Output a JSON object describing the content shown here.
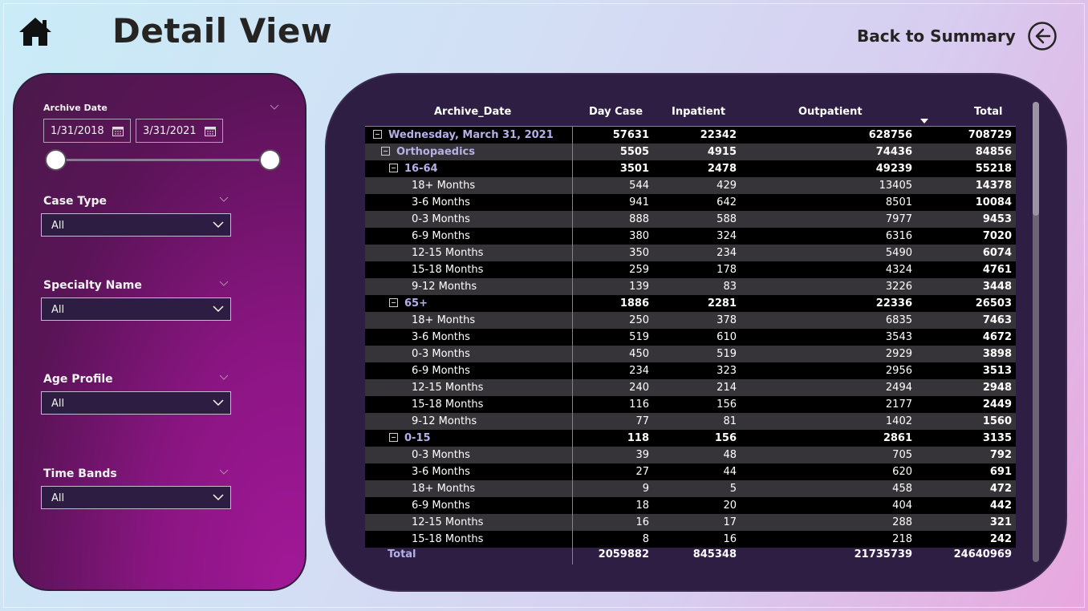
{
  "header": {
    "title": "Detail View",
    "back_label": "Back to Summary",
    "home_icon": "home-icon",
    "back_icon": "arrow-left-circle-icon"
  },
  "filters": {
    "archive_date": {
      "label": "Archive Date",
      "start": "1/31/2018",
      "end": "3/31/2021",
      "range_fraction": [
        0.0,
        1.0
      ]
    },
    "case_type": {
      "label": "Case Type",
      "value": "All"
    },
    "specialty_name": {
      "label": "Specialty Name",
      "value": "All"
    },
    "age_profile": {
      "label": "Age Profile",
      "value": "All"
    },
    "time_bands": {
      "label": "Time Bands",
      "value": "All"
    }
  },
  "table": {
    "columns": [
      "Archive_Date",
      "Day Case",
      "Inpatient",
      "Outpatient",
      "Total"
    ],
    "sorted_column": "Outpatient",
    "rows": [
      {
        "label": "Wednesday, March 31, 2021",
        "level": 0,
        "group": true,
        "expander": true,
        "day": "57631",
        "inp": "22342",
        "out": "628756",
        "tot": "708729"
      },
      {
        "label": "Orthopaedics",
        "level": 1,
        "group": true,
        "expander": true,
        "day": "5505",
        "inp": "4915",
        "out": "74436",
        "tot": "84856"
      },
      {
        "label": "16-64",
        "level": 2,
        "group": true,
        "expander": true,
        "day": "3501",
        "inp": "2478",
        "out": "49239",
        "tot": "55218"
      },
      {
        "label": "18+ Months",
        "level": 3,
        "day": "544",
        "inp": "429",
        "out": "13405",
        "tot": "14378"
      },
      {
        "label": "3-6 Months",
        "level": 3,
        "day": "941",
        "inp": "642",
        "out": "8501",
        "tot": "10084"
      },
      {
        "label": "0-3 Months",
        "level": 3,
        "day": "888",
        "inp": "588",
        "out": "7977",
        "tot": "9453"
      },
      {
        "label": "6-9 Months",
        "level": 3,
        "day": "380",
        "inp": "324",
        "out": "6316",
        "tot": "7020"
      },
      {
        "label": "12-15 Months",
        "level": 3,
        "day": "350",
        "inp": "234",
        "out": "5490",
        "tot": "6074"
      },
      {
        "label": "15-18 Months",
        "level": 3,
        "day": "259",
        "inp": "178",
        "out": "4324",
        "tot": "4761"
      },
      {
        "label": "9-12 Months",
        "level": 3,
        "day": "139",
        "inp": "83",
        "out": "3226",
        "tot": "3448"
      },
      {
        "label": "65+",
        "level": 2,
        "group": true,
        "expander": true,
        "day": "1886",
        "inp": "2281",
        "out": "22336",
        "tot": "26503"
      },
      {
        "label": "18+ Months",
        "level": 3,
        "day": "250",
        "inp": "378",
        "out": "6835",
        "tot": "7463"
      },
      {
        "label": "3-6 Months",
        "level": 3,
        "day": "519",
        "inp": "610",
        "out": "3543",
        "tot": "4672"
      },
      {
        "label": "0-3 Months",
        "level": 3,
        "day": "450",
        "inp": "519",
        "out": "2929",
        "tot": "3898"
      },
      {
        "label": "6-9 Months",
        "level": 3,
        "day": "234",
        "inp": "323",
        "out": "2956",
        "tot": "3513"
      },
      {
        "label": "12-15 Months",
        "level": 3,
        "day": "240",
        "inp": "214",
        "out": "2494",
        "tot": "2948"
      },
      {
        "label": "15-18 Months",
        "level": 3,
        "day": "116",
        "inp": "156",
        "out": "2177",
        "tot": "2449"
      },
      {
        "label": "9-12 Months",
        "level": 3,
        "day": "77",
        "inp": "81",
        "out": "1402",
        "tot": "1560"
      },
      {
        "label": "0-15",
        "level": 2,
        "group": true,
        "expander": true,
        "day": "118",
        "inp": "156",
        "out": "2861",
        "tot": "3135"
      },
      {
        "label": "0-3 Months",
        "level": 3,
        "day": "39",
        "inp": "48",
        "out": "705",
        "tot": "792"
      },
      {
        "label": "3-6 Months",
        "level": 3,
        "day": "27",
        "inp": "44",
        "out": "620",
        "tot": "691"
      },
      {
        "label": "18+ Months",
        "level": 3,
        "day": "9",
        "inp": "5",
        "out": "458",
        "tot": "472"
      },
      {
        "label": "6-9 Months",
        "level": 3,
        "day": "18",
        "inp": "20",
        "out": "404",
        "tot": "442"
      },
      {
        "label": "12-15 Months",
        "level": 3,
        "day": "16",
        "inp": "17",
        "out": "288",
        "tot": "321"
      },
      {
        "label": "15-18 Months",
        "level": 3,
        "day": "8",
        "inp": "16",
        "out": "218",
        "tot": "242"
      }
    ],
    "total": {
      "label": "Total",
      "day": "2059882",
      "inp": "845348",
      "out": "21735739",
      "tot": "24640969"
    }
  },
  "colors": {
    "accent_line": "#5b8ad8",
    "group_text": "#b5b0e8",
    "panel_bg": "#2f1e44",
    "filter_panel": "#8a1582"
  }
}
